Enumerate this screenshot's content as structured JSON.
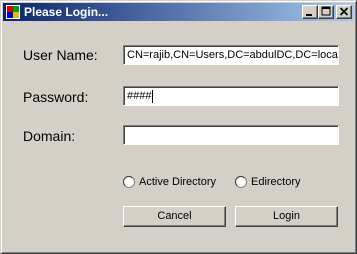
{
  "window": {
    "title": "Please Login...",
    "icon": "windows-flag-icon",
    "controls": [
      "minimize-icon",
      "maximize-icon",
      "close-icon"
    ]
  },
  "form": {
    "username": {
      "label": "User Name:",
      "value": "CN=rajib,CN=Users,DC=abdulDC,DC=local"
    },
    "password": {
      "label": "Password:",
      "value": "####"
    },
    "domain": {
      "label": "Domain:",
      "value": ""
    }
  },
  "auth_type": {
    "options": [
      {
        "label": "Active Directory",
        "selected": false
      },
      {
        "label": "Edirectory",
        "selected": false
      }
    ]
  },
  "buttons": {
    "cancel": "Cancel",
    "login": "Login"
  },
  "colors": {
    "face": "#d4d0c8",
    "title_start": "#0a246a",
    "title_end": "#a6caf0"
  }
}
